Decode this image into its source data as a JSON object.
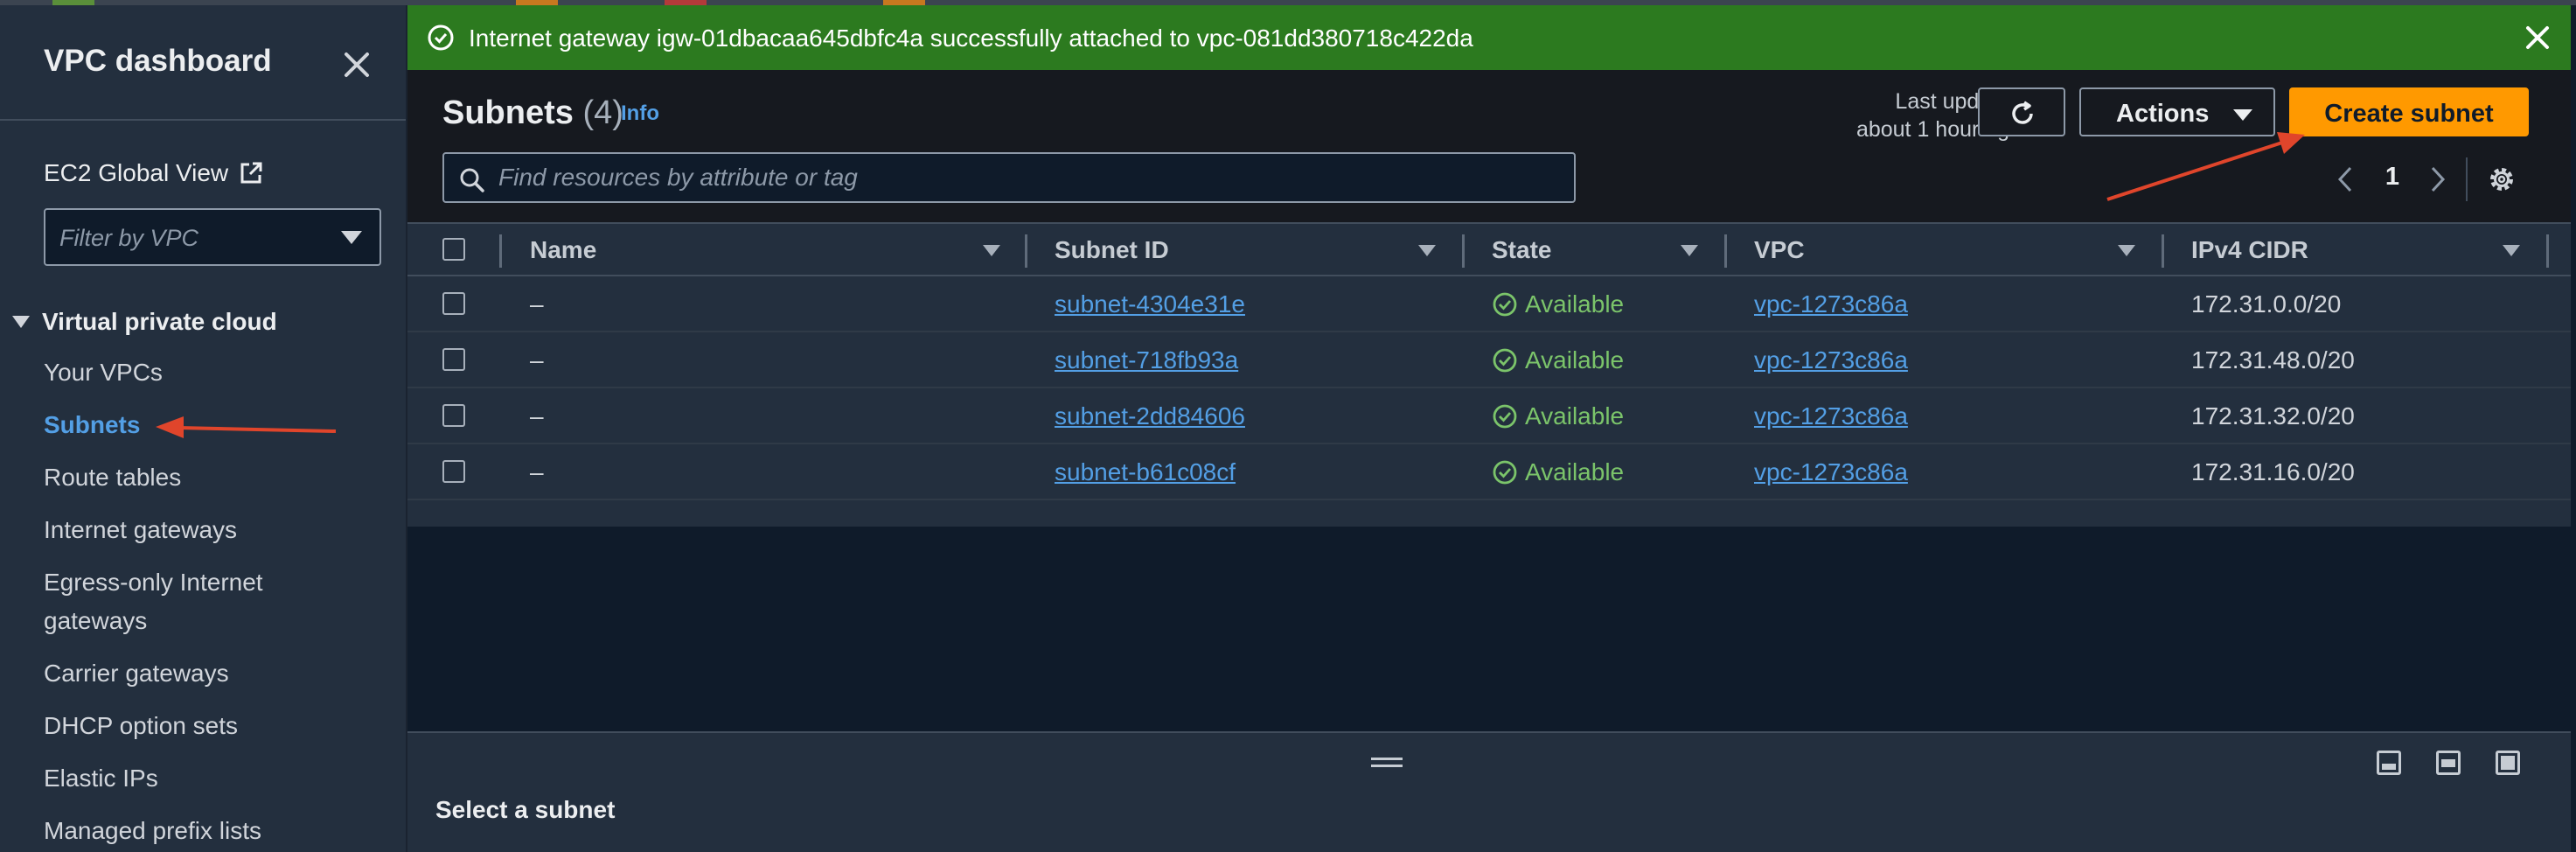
{
  "flash": {
    "message": "Internet gateway igw-01dbacaa645dbfc4a successfully attached to vpc-081dd380718c422da"
  },
  "sidebar": {
    "title": "VPC dashboard",
    "global_view": "EC2 Global View",
    "filter_placeholder": "Filter by VPC",
    "section": "Virtual private cloud",
    "items": [
      {
        "label": "Your VPCs",
        "active": false
      },
      {
        "label": "Subnets",
        "active": true
      },
      {
        "label": "Route tables",
        "active": false
      },
      {
        "label": "Internet gateways",
        "active": false
      },
      {
        "label": "Egress-only Internet",
        "active": false
      },
      {
        "label": "gateways",
        "active": false
      },
      {
        "label": "Carrier gateways",
        "active": false
      },
      {
        "label": "DHCP option sets",
        "active": false
      },
      {
        "label": "Elastic IPs",
        "active": false
      },
      {
        "label": "Managed prefix lists",
        "active": false
      }
    ]
  },
  "panel": {
    "title": "Subnets",
    "count": "(4)",
    "info": "Info",
    "last_updated_line1": "Last updated",
    "last_updated_line2": "about 1 hour ago",
    "actions_label": "Actions",
    "create_label": "Create subnet",
    "search_placeholder": "Find resources by attribute or tag",
    "page": "1"
  },
  "table": {
    "columns": [
      "Name",
      "Subnet ID",
      "State",
      "VPC",
      "IPv4 CIDR"
    ],
    "rows": [
      {
        "name": "–",
        "subnet_id": "subnet-4304e31e",
        "state": "Available",
        "vpc": "vpc-1273c86a",
        "cidr": "172.31.0.0/20"
      },
      {
        "name": "–",
        "subnet_id": "subnet-718fb93a",
        "state": "Available",
        "vpc": "vpc-1273c86a",
        "cidr": "172.31.48.0/20"
      },
      {
        "name": "–",
        "subnet_id": "subnet-2dd84606",
        "state": "Available",
        "vpc": "vpc-1273c86a",
        "cidr": "172.31.32.0/20"
      },
      {
        "name": "–",
        "subnet_id": "subnet-b61c08cf",
        "state": "Available",
        "vpc": "vpc-1273c86a",
        "cidr": "172.31.16.0/20"
      }
    ]
  },
  "split_panel": {
    "title": "Select a subnet"
  },
  "colors": {
    "accent_orange": "#ff9900",
    "link_blue": "#539fe5",
    "success_green": "#2c7a1f",
    "status_green": "#7bc46a",
    "annotation_red": "#e0452b"
  },
  "icons": [
    "close-icon",
    "external-link-icon",
    "check-circle-icon",
    "refresh-icon",
    "search-icon",
    "chevron-left-icon",
    "chevron-right-icon",
    "settings-gear-icon",
    "panel-layout-icon"
  ]
}
